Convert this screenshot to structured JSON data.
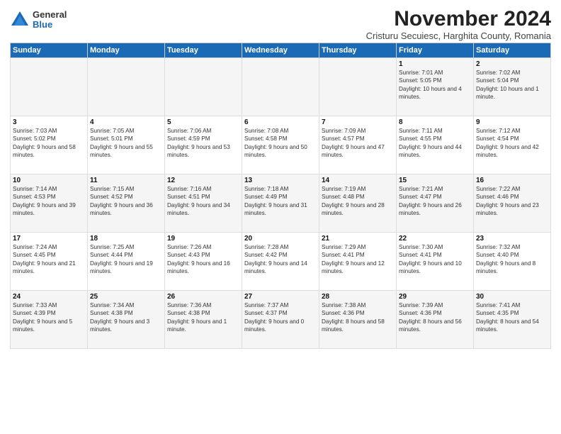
{
  "header": {
    "logo_general": "General",
    "logo_blue": "Blue",
    "month_title": "November 2024",
    "subtitle": "Cristuru Secuiesc, Harghita County, Romania"
  },
  "days_of_week": [
    "Sunday",
    "Monday",
    "Tuesday",
    "Wednesday",
    "Thursday",
    "Friday",
    "Saturday"
  ],
  "weeks": [
    [
      {
        "day": "",
        "content": ""
      },
      {
        "day": "",
        "content": ""
      },
      {
        "day": "",
        "content": ""
      },
      {
        "day": "",
        "content": ""
      },
      {
        "day": "",
        "content": ""
      },
      {
        "day": "1",
        "content": "Sunrise: 7:01 AM\nSunset: 5:05 PM\nDaylight: 10 hours and 4 minutes."
      },
      {
        "day": "2",
        "content": "Sunrise: 7:02 AM\nSunset: 5:04 PM\nDaylight: 10 hours and 1 minute."
      }
    ],
    [
      {
        "day": "3",
        "content": "Sunrise: 7:03 AM\nSunset: 5:02 PM\nDaylight: 9 hours and 58 minutes."
      },
      {
        "day": "4",
        "content": "Sunrise: 7:05 AM\nSunset: 5:01 PM\nDaylight: 9 hours and 55 minutes."
      },
      {
        "day": "5",
        "content": "Sunrise: 7:06 AM\nSunset: 4:59 PM\nDaylight: 9 hours and 53 minutes."
      },
      {
        "day": "6",
        "content": "Sunrise: 7:08 AM\nSunset: 4:58 PM\nDaylight: 9 hours and 50 minutes."
      },
      {
        "day": "7",
        "content": "Sunrise: 7:09 AM\nSunset: 4:57 PM\nDaylight: 9 hours and 47 minutes."
      },
      {
        "day": "8",
        "content": "Sunrise: 7:11 AM\nSunset: 4:55 PM\nDaylight: 9 hours and 44 minutes."
      },
      {
        "day": "9",
        "content": "Sunrise: 7:12 AM\nSunset: 4:54 PM\nDaylight: 9 hours and 42 minutes."
      }
    ],
    [
      {
        "day": "10",
        "content": "Sunrise: 7:14 AM\nSunset: 4:53 PM\nDaylight: 9 hours and 39 minutes."
      },
      {
        "day": "11",
        "content": "Sunrise: 7:15 AM\nSunset: 4:52 PM\nDaylight: 9 hours and 36 minutes."
      },
      {
        "day": "12",
        "content": "Sunrise: 7:16 AM\nSunset: 4:51 PM\nDaylight: 9 hours and 34 minutes."
      },
      {
        "day": "13",
        "content": "Sunrise: 7:18 AM\nSunset: 4:49 PM\nDaylight: 9 hours and 31 minutes."
      },
      {
        "day": "14",
        "content": "Sunrise: 7:19 AM\nSunset: 4:48 PM\nDaylight: 9 hours and 28 minutes."
      },
      {
        "day": "15",
        "content": "Sunrise: 7:21 AM\nSunset: 4:47 PM\nDaylight: 9 hours and 26 minutes."
      },
      {
        "day": "16",
        "content": "Sunrise: 7:22 AM\nSunset: 4:46 PM\nDaylight: 9 hours and 23 minutes."
      }
    ],
    [
      {
        "day": "17",
        "content": "Sunrise: 7:24 AM\nSunset: 4:45 PM\nDaylight: 9 hours and 21 minutes."
      },
      {
        "day": "18",
        "content": "Sunrise: 7:25 AM\nSunset: 4:44 PM\nDaylight: 9 hours and 19 minutes."
      },
      {
        "day": "19",
        "content": "Sunrise: 7:26 AM\nSunset: 4:43 PM\nDaylight: 9 hours and 16 minutes."
      },
      {
        "day": "20",
        "content": "Sunrise: 7:28 AM\nSunset: 4:42 PM\nDaylight: 9 hours and 14 minutes."
      },
      {
        "day": "21",
        "content": "Sunrise: 7:29 AM\nSunset: 4:41 PM\nDaylight: 9 hours and 12 minutes."
      },
      {
        "day": "22",
        "content": "Sunrise: 7:30 AM\nSunset: 4:41 PM\nDaylight: 9 hours and 10 minutes."
      },
      {
        "day": "23",
        "content": "Sunrise: 7:32 AM\nSunset: 4:40 PM\nDaylight: 9 hours and 8 minutes."
      }
    ],
    [
      {
        "day": "24",
        "content": "Sunrise: 7:33 AM\nSunset: 4:39 PM\nDaylight: 9 hours and 5 minutes."
      },
      {
        "day": "25",
        "content": "Sunrise: 7:34 AM\nSunset: 4:38 PM\nDaylight: 9 hours and 3 minutes."
      },
      {
        "day": "26",
        "content": "Sunrise: 7:36 AM\nSunset: 4:38 PM\nDaylight: 9 hours and 1 minute."
      },
      {
        "day": "27",
        "content": "Sunrise: 7:37 AM\nSunset: 4:37 PM\nDaylight: 9 hours and 0 minutes."
      },
      {
        "day": "28",
        "content": "Sunrise: 7:38 AM\nSunset: 4:36 PM\nDaylight: 8 hours and 58 minutes."
      },
      {
        "day": "29",
        "content": "Sunrise: 7:39 AM\nSunset: 4:36 PM\nDaylight: 8 hours and 56 minutes."
      },
      {
        "day": "30",
        "content": "Sunrise: 7:41 AM\nSunset: 4:35 PM\nDaylight: 8 hours and 54 minutes."
      }
    ]
  ]
}
